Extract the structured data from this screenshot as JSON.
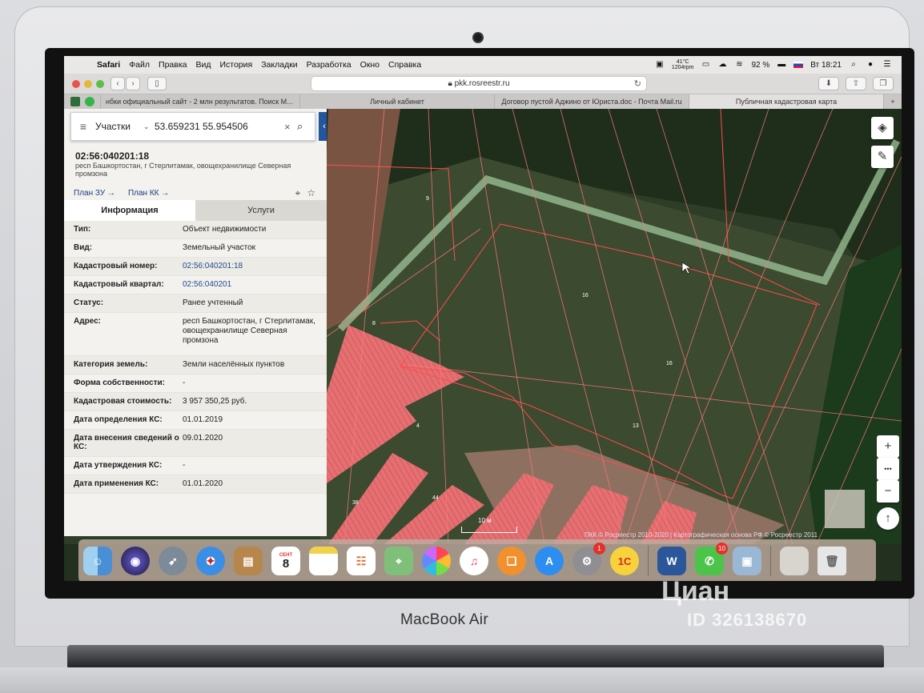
{
  "menubar": {
    "app_name": "Safari",
    "items": [
      "Файл",
      "Правка",
      "Вид",
      "История",
      "Закладки",
      "Разработка",
      "Окно",
      "Справка"
    ],
    "temperature": "41°C",
    "temp_sub": "1204rpm",
    "battery": "92 %",
    "clock": "Вт 18:21"
  },
  "browser": {
    "url": "pkk.rosreestr.ru",
    "tabs": [
      "нбки официальный сайт - 2 млн результатов. Поиск М...",
      "Личный кабинет",
      "Договор пустой Аджино от Юриста.doc - Почта Mail.ru",
      "Публичная кадастровая карта"
    ],
    "active_tab": 3
  },
  "search": {
    "type": "Участки",
    "query": "53.659231 55.954506"
  },
  "parcel": {
    "cadastral_number": "02:56:040201:18",
    "address_short": "респ Башкортостан, г Стерлитамак, овощехранилище Северная промзона",
    "plan_zu": "План ЗУ →",
    "plan_kk": "План КК →",
    "tab_info": "Информация",
    "tab_services": "Услуги",
    "fields": [
      {
        "label": "Тип:",
        "value": "Объект недвижимости"
      },
      {
        "label": "Вид:",
        "value": "Земельный участок"
      },
      {
        "label": "Кадастровый номер:",
        "value": "02:56:040201:18"
      },
      {
        "label": "Кадастровый квартал:",
        "value": "02:56:040201"
      },
      {
        "label": "Статус:",
        "value": "Ранее учтенный"
      },
      {
        "label": "Адрес:",
        "value": "респ Башкортостан, г Стерлитамак, овощехранилище Северная промзона"
      },
      {
        "label": "Категория земель:",
        "value": "Земли населённых пунктов"
      },
      {
        "label": "Форма собственности:",
        "value": "-"
      },
      {
        "label": "Кадастровая стоимость:",
        "value": "3 957 350,25 руб."
      },
      {
        "label": "Дата определения КС:",
        "value": "01.01.2019"
      },
      {
        "label": "Дата внесения сведений о КС:",
        "value": "09.01.2020"
      },
      {
        "label": "Дата утверждения КС:",
        "value": "-"
      },
      {
        "label": "Дата применения КС:",
        "value": "01.01.2020"
      }
    ]
  },
  "map": {
    "labels": [
      "9",
      "16",
      "16",
      "13",
      "8",
      "38",
      "44",
      "4"
    ],
    "scale": "10 м",
    "copyright": "ПКК © Росреестр 2010-2020 | Картографическая основа РФ © Росреестр 2011",
    "zoom_in": "+",
    "zoom_more": "•••",
    "zoom_out": "−"
  },
  "dock": {
    "calendar_month": "СЕНТ",
    "calendar_day": "8",
    "app_1c": "1С",
    "word": "W",
    "prefs_badge": "1",
    "facetime_badge": "10"
  },
  "laptop": {
    "model": "MacBook Air"
  },
  "watermark": {
    "brand": "Циан",
    "id": "ID 326138670"
  }
}
